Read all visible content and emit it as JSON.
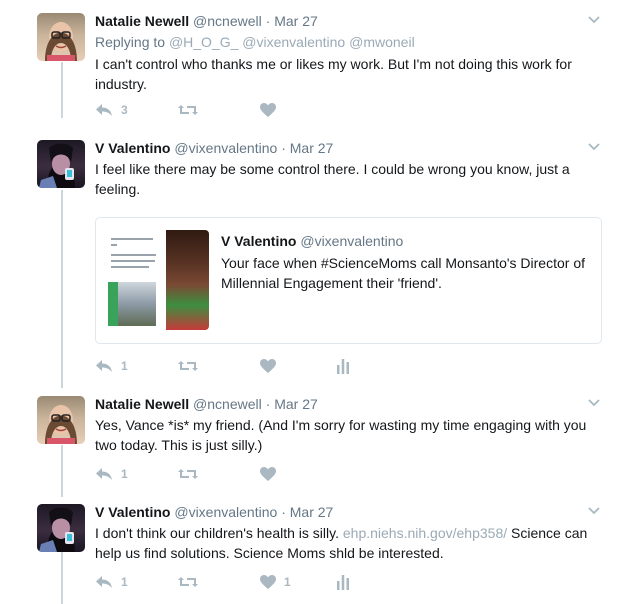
{
  "tweets": [
    {
      "name": "Natalie Newell",
      "handle": "@ncnewell",
      "time": "Mar 27",
      "replying_label": "Replying to",
      "replying_mentions": "@H_O_G_ @vixenvalentino @mwoneil",
      "text": "I can't control who thanks me or likes my work. But I'm not doing this work for industry.",
      "reply_count": "3",
      "retweet_count": "",
      "like_count": ""
    },
    {
      "name": "V Valentino",
      "handle": "@vixenvalentino",
      "time": "Mar 27",
      "text": "I feel like there may be some control there. I could be wrong you know, just a feeling.",
      "reply_count": "1",
      "retweet_count": "",
      "like_count": "",
      "quote": {
        "name": "V Valentino",
        "handle": "@vixenvalentino",
        "text": "Your face when #ScienceMoms call Monsanto's Director of Millennial Engagement their 'friend'."
      }
    },
    {
      "name": "Natalie Newell",
      "handle": "@ncnewell",
      "time": "Mar 27",
      "text": "Yes, Vance *is* my friend. (And I'm sorry for wasting my time engaging with you two today. This is just silly.)",
      "reply_count": "1",
      "retweet_count": "",
      "like_count": ""
    },
    {
      "name": "V Valentino",
      "handle": "@vixenvalentino",
      "time": "Mar 27",
      "text_before": "I don't think our children's health is silly.",
      "link": "ehp.niehs.nih.gov/ehp358/",
      "text_after": "Science can help us find solutions. Science Moms shld be interested.",
      "reply_count": "1",
      "retweet_count": "",
      "like_count": "1"
    }
  ],
  "dot": "·",
  "icons": [
    "reply-icon",
    "retweet-icon",
    "like-icon",
    "analytics-icon",
    "chevron-down-icon"
  ],
  "colors": {
    "icon": "#aab8c2",
    "secondary_text": "#657786",
    "link": "#9aaab6",
    "thread_line": "#ccd6dd"
  }
}
